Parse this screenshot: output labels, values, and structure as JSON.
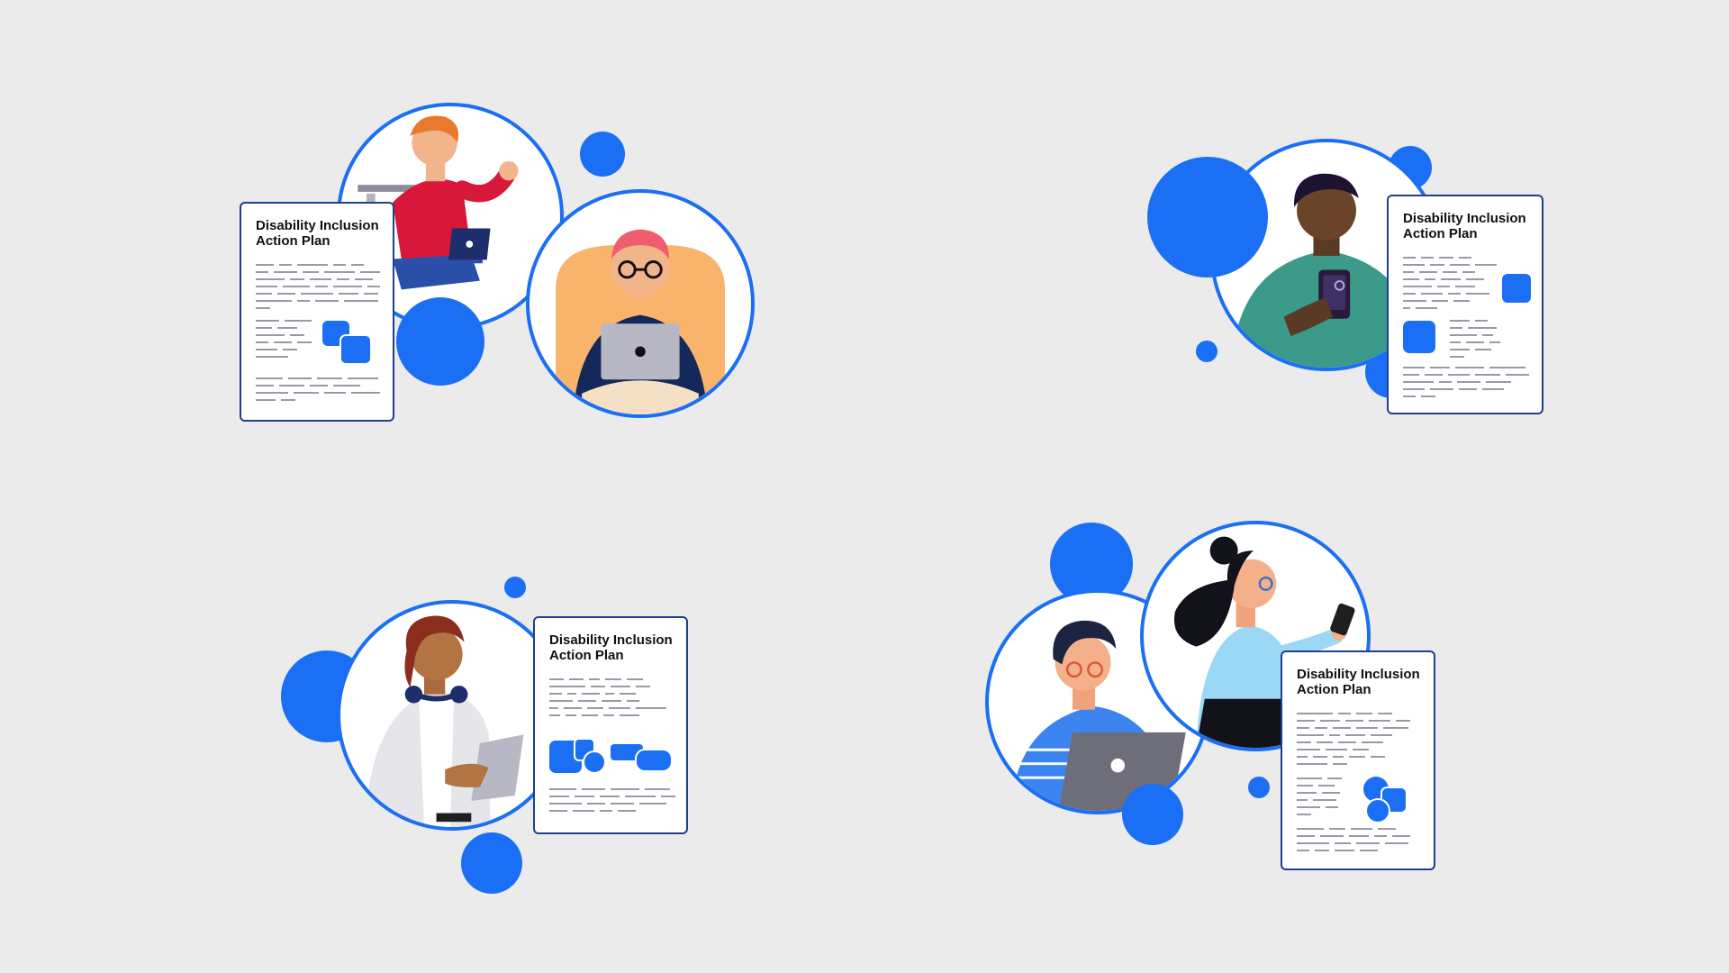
{
  "colors": {
    "background": "#ebebeb",
    "accent": "#1a6ff5",
    "doc_border": "#1f3f8f",
    "line": "#9a9aa6"
  },
  "cards": [
    {
      "title": "Disability Inclusion Action Plan",
      "people": [
        "person-waving-with-laptop-icon",
        "person-with-tablet-icon"
      ]
    },
    {
      "title": "Disability Inclusion Action Plan",
      "people": [
        "person-with-phone-icon"
      ]
    },
    {
      "title": "Disability Inclusion Action Plan",
      "people": [
        "person-with-headphones-icon"
      ]
    },
    {
      "title": "Disability Inclusion Action Plan",
      "people": [
        "person-at-laptop-icon",
        "person-pointing-at-phone-icon"
      ]
    }
  ]
}
